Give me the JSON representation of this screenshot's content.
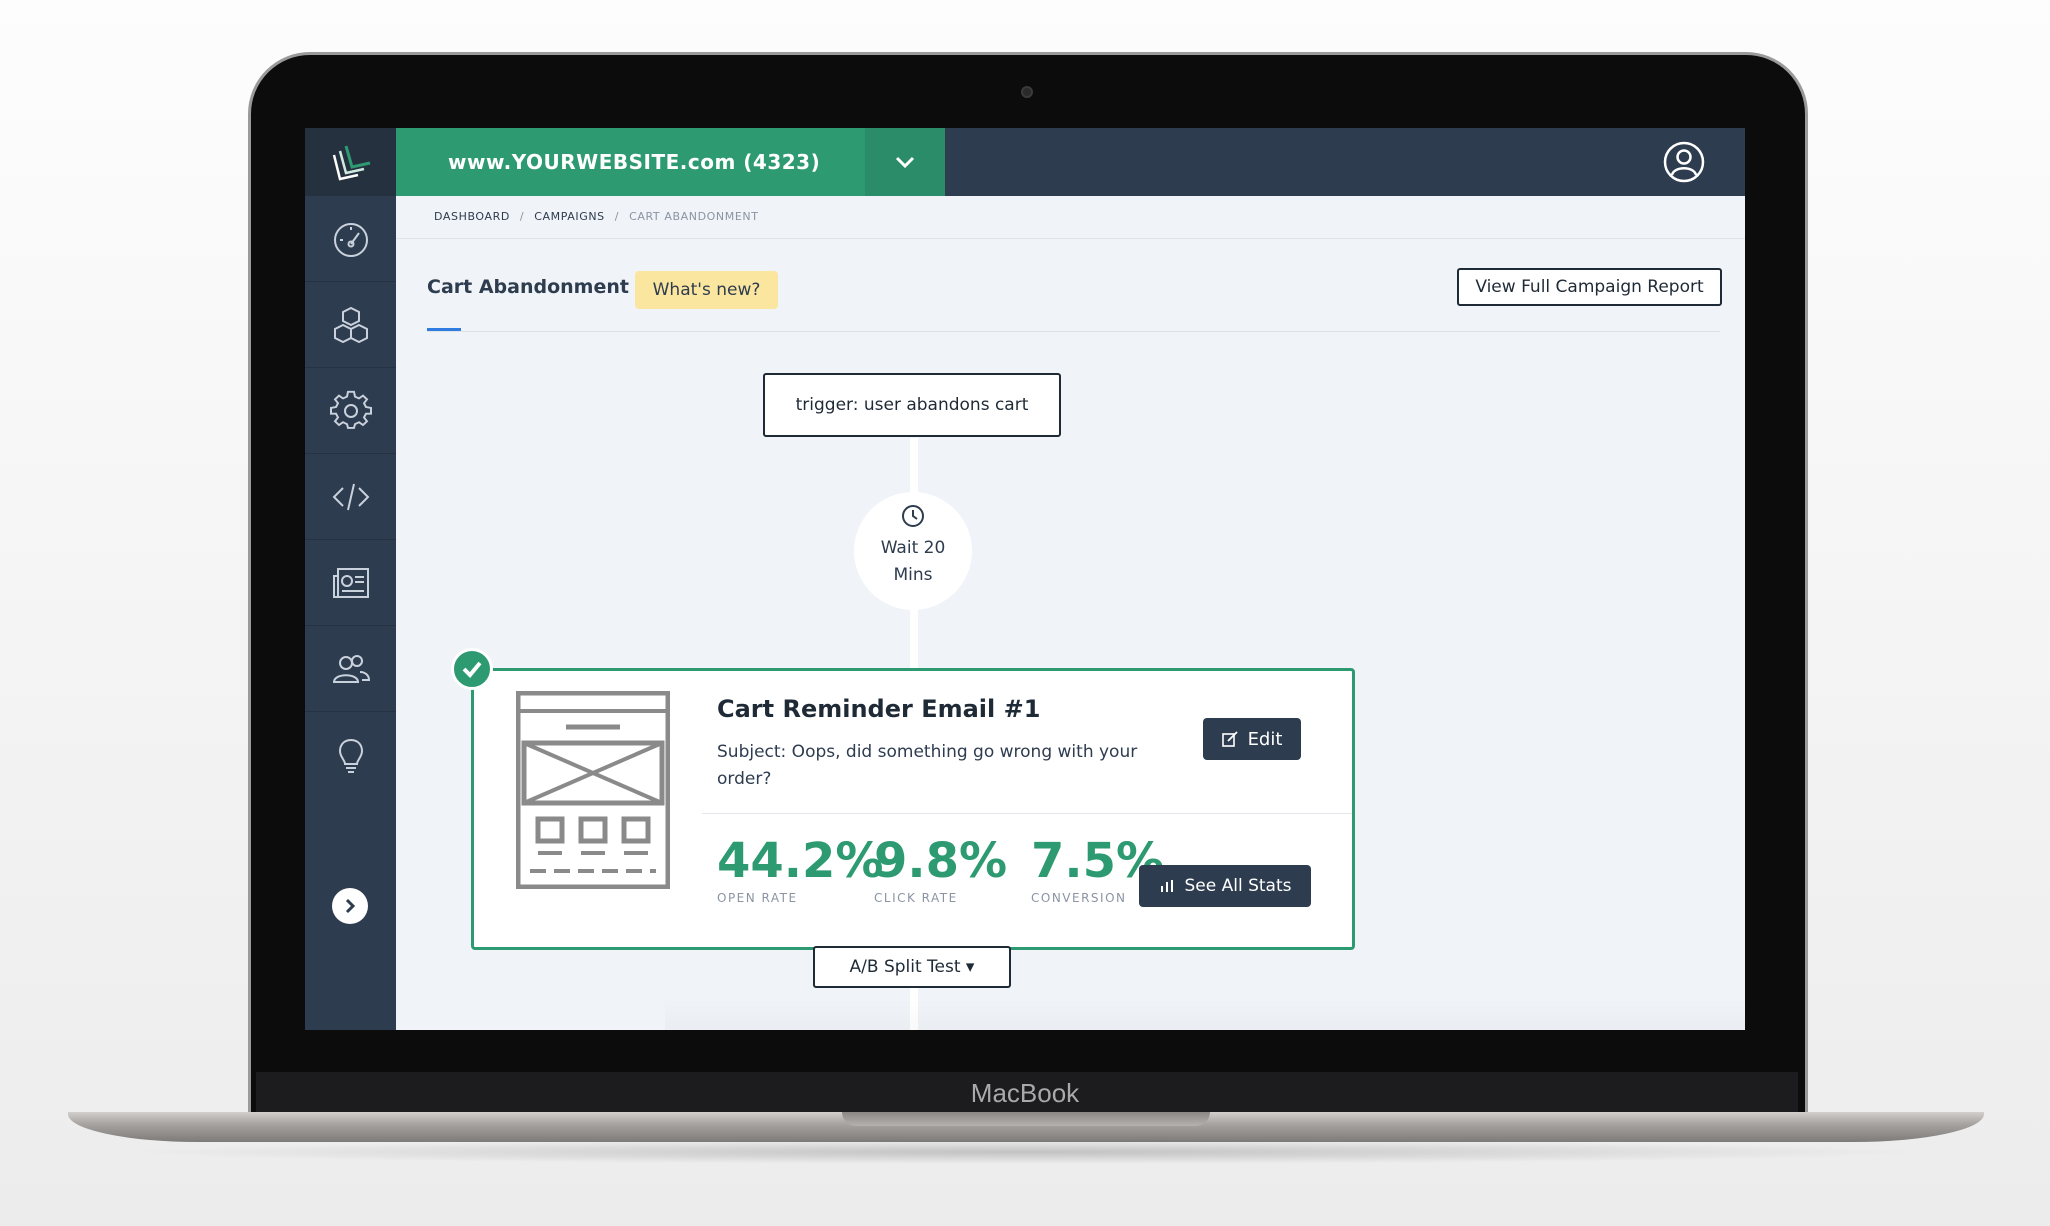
{
  "device": {
    "brand": "MacBook"
  },
  "topbar": {
    "site_name": "www.YOURWEBSITE.com (4323)"
  },
  "sidebar": {
    "items": [
      {
        "icon": "dashboard-gauge-icon"
      },
      {
        "icon": "cubes-icon"
      },
      {
        "icon": "gear-icon"
      },
      {
        "icon": "code-icon"
      },
      {
        "icon": "newspaper-icon"
      },
      {
        "icon": "users-icon"
      },
      {
        "icon": "lightbulb-icon"
      }
    ],
    "expand_icon": "chevron-right-icon"
  },
  "breadcrumb": [
    "DASHBOARD",
    "CAMPAIGNS",
    "CART ABANDONMENT"
  ],
  "page": {
    "title": "Cart Abandonment",
    "whats_new": "What's new?",
    "report_button": "View Full Campaign Report"
  },
  "flow": {
    "trigger": "trigger: user abandons cart",
    "wait_label": "Wait 20 Mins",
    "email": {
      "title": "Cart Reminder Email #1",
      "subject": "Subject: Oops, did something go wrong with your order?",
      "edit_label": "Edit",
      "stats": [
        {
          "value": "44.2%",
          "label": "OPEN RATE"
        },
        {
          "value": "9.8%",
          "label": "CLICK RATE"
        },
        {
          "value": "7.5%",
          "label": "CONVERSION"
        }
      ],
      "see_stats_label": "See All Stats"
    },
    "ab_test_label": "A/B Split Test"
  },
  "colors": {
    "accent_green": "#2e9a72",
    "navy": "#2e3c4f",
    "highlight_yellow": "#fbe6a0",
    "tab_blue": "#2f7de1"
  }
}
